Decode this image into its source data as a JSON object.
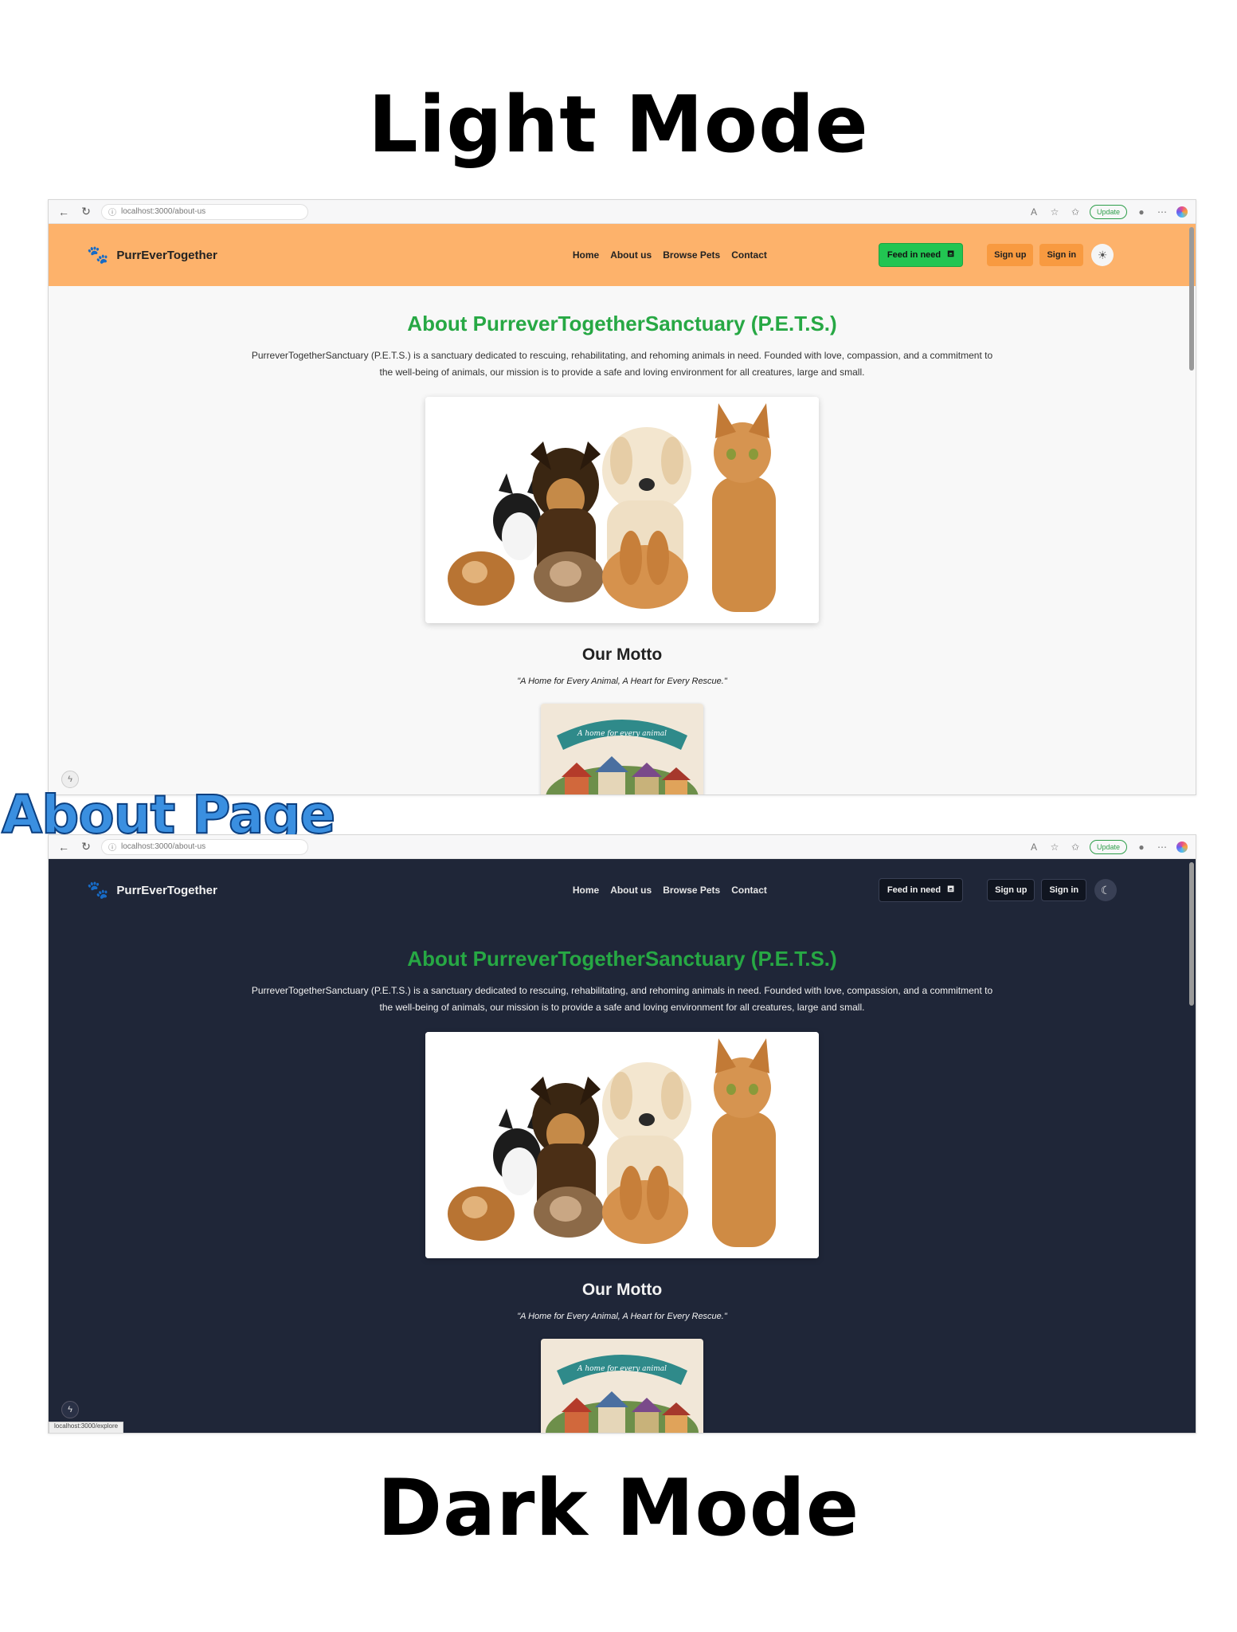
{
  "headings": {
    "light": "Light Mode",
    "dark": "Dark Mode",
    "page_label": "About Page"
  },
  "browser": {
    "url_light": "localhost:3000/about-us",
    "url_dark": "localhost:3000/about-us",
    "update_label": "Update",
    "status_url": "localhost:3000/explore"
  },
  "site": {
    "brand": "PurrEverTogether",
    "nav": [
      "Home",
      "About us",
      "Browse Pets",
      "Contact"
    ],
    "feed_label": "Feed in need",
    "signup_label": "Sign up",
    "signin_label": "Sign in"
  },
  "about": {
    "title": "About PurreverTogetherSanctuary (P.E.T.S.)",
    "description": "PurreverTogetherSanctuary (P.E.T.S.) is a sanctuary dedicated to rescuing, rehabilitating, and rehoming animals in need. Founded with love, compassion, and a commitment to the well-being of animals, our mission is to provide a safe and loving environment for all creatures, large and small.",
    "motto_title": "Our Motto",
    "motto_text": "\"A Home for Every Animal, A Heart for Every Rescue.\"",
    "motto_banner": "A home for every animal"
  },
  "icons": {
    "back": "arrow-left-icon",
    "reload": "reload-icon",
    "info": "info-icon",
    "read_aloud": "read-aloud-icon",
    "favorite": "star-icon",
    "favorites": "favorites-icon",
    "profile": "profile-icon",
    "more": "more-icon",
    "copilot": "copilot-icon",
    "paw": "paw-icon",
    "bowl": "bowl-icon",
    "sun": "sun-icon",
    "moon": "moon-icon"
  },
  "colors": {
    "header_light": "#fdb26b",
    "accent_orange": "#f89a40",
    "feed_green": "#22c552",
    "title_green": "#27a844",
    "dark_bg": "#1f2638",
    "page_label_blue": "#3a8fe0"
  }
}
